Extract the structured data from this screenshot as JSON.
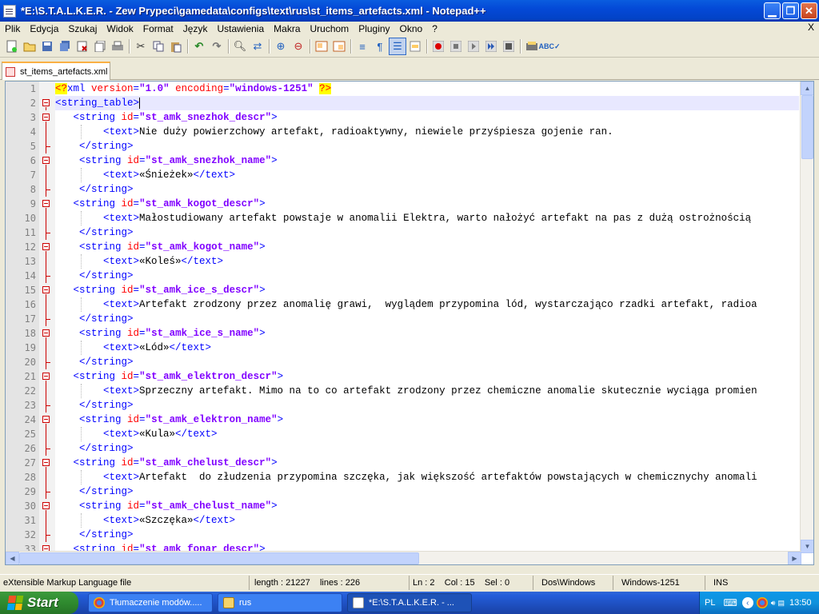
{
  "window": {
    "title": "*E:\\S.T.A.L.K.E.R. - Zew Prypeci\\gamedata\\configs\\text\\rus\\st_items_artefacts.xml - Notepad++"
  },
  "menu": [
    "Plik",
    "Edycja",
    "Szukaj",
    "Widok",
    "Format",
    "Język",
    "Ustawienia",
    "Makra",
    "Uruchom",
    "Pluginy",
    "Okno",
    "?"
  ],
  "menu_close": "X",
  "tab": {
    "label": "st_items_artefacts.xml"
  },
  "editor": {
    "current_line": 2,
    "lines": [
      {
        "n": "1",
        "kind": "pi"
      },
      {
        "n": "2",
        "kind": "open",
        "text": "string_table"
      },
      {
        "n": "3",
        "kind": "sopen",
        "id": "st_amk_snezhok_descr",
        "indent": "   "
      },
      {
        "n": "4",
        "kind": "text",
        "body": "Nie duży powierzchowy artefakt, radioaktywny, niewiele przyśpiesza gojenie ran."
      },
      {
        "n": "5",
        "kind": "sclose"
      },
      {
        "n": "6",
        "kind": "sopen",
        "id": "st_amk_snezhok_name",
        "indent": "    "
      },
      {
        "n": "7",
        "kind": "text",
        "body": "«Śnieżek»"
      },
      {
        "n": "8",
        "kind": "sclose"
      },
      {
        "n": "9",
        "kind": "sopen",
        "id": "st_amk_kogot_descr",
        "indent": "   "
      },
      {
        "n": "10",
        "kind": "text",
        "body": "Małostudiowany artefakt powstaje w anomalii Elektra, warto nałożyć artefakt na pas z dużą ostrożnością"
      },
      {
        "n": "11",
        "kind": "sclose"
      },
      {
        "n": "12",
        "kind": "sopen",
        "id": "st_amk_kogot_name",
        "indent": "    "
      },
      {
        "n": "13",
        "kind": "text",
        "body": "«Koleś»"
      },
      {
        "n": "14",
        "kind": "sclose"
      },
      {
        "n": "15",
        "kind": "sopen",
        "id": "st_amk_ice_s_descr",
        "indent": "   "
      },
      {
        "n": "16",
        "kind": "text",
        "body": "Artefakt zrodzony przez anomalię grawi,  wyglądem przypomina lód, wystarczająco rzadki artefakt, radioa"
      },
      {
        "n": "17",
        "kind": "sclose"
      },
      {
        "n": "18",
        "kind": "sopen",
        "id": "st_amk_ice_s_name",
        "indent": "    "
      },
      {
        "n": "19",
        "kind": "text",
        "body": "«Lód»"
      },
      {
        "n": "20",
        "kind": "sclose"
      },
      {
        "n": "21",
        "kind": "sopen",
        "id": "st_amk_elektron_descr",
        "indent": "   "
      },
      {
        "n": "22",
        "kind": "text",
        "body": "Sprzeczny artefakt. Mimo na to co artefakt zrodzony przez chemiczne anomalie skutecznie wyciąga promien"
      },
      {
        "n": "23",
        "kind": "sclose"
      },
      {
        "n": "24",
        "kind": "sopen",
        "id": "st_amk_elektron_name",
        "indent": "    "
      },
      {
        "n": "25",
        "kind": "text",
        "body": "«Kula»"
      },
      {
        "n": "26",
        "kind": "sclose"
      },
      {
        "n": "27",
        "kind": "sopen",
        "id": "st_amk_chelust_descr",
        "indent": "   "
      },
      {
        "n": "28",
        "kind": "text",
        "body": "Artefakt  do złudzenia przypomina szczęka, jak większość artefaktów powstających w chemicznychy anomali"
      },
      {
        "n": "29",
        "kind": "sclose"
      },
      {
        "n": "30",
        "kind": "sopen",
        "id": "st_amk_chelust_name",
        "indent": "    "
      },
      {
        "n": "31",
        "kind": "text",
        "body": "«Szczęka»"
      },
      {
        "n": "32",
        "kind": "sclose"
      },
      {
        "n": "33",
        "kind": "sopen",
        "id": "st_amk_fonar_descr",
        "indent": "   "
      }
    ],
    "pi": {
      "open": "<?",
      "name": "xml",
      "version_attr": "version",
      "version": "\"1.0\"",
      "enc_attr": "encoding",
      "enc": "\"windows-1251\"",
      "close": "?>"
    }
  },
  "status": {
    "type": "eXtensible Markup Language file",
    "length": "length : 21227",
    "lines": "lines : 226",
    "pos": "Ln : 2    Col : 15    Sel : 0",
    "eol": "Dos\\Windows",
    "encoding": "Windows-1251",
    "mode": "INS"
  },
  "taskbar": {
    "start": "Start",
    "tasks": [
      "Tłumaczenie modów.....",
      "rus",
      "*E:\\S.T.A.L.K.E.R. - ..."
    ],
    "lang": "PL",
    "time": "13:50"
  }
}
